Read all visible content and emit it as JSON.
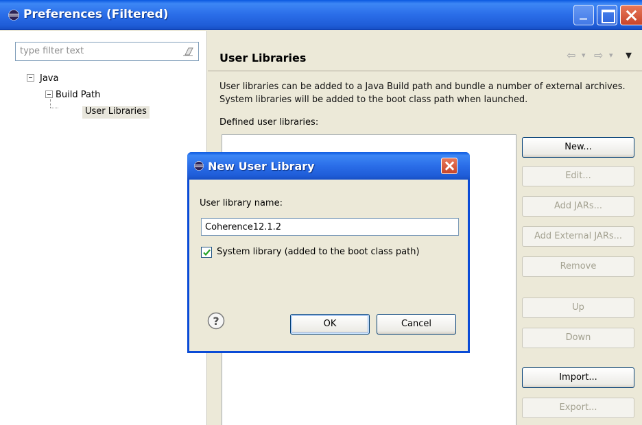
{
  "window": {
    "title": "Preferences (Filtered)"
  },
  "left_pane": {
    "filter_placeholder": "type filter text",
    "tree": {
      "java": "Java",
      "build_path": "Build Path",
      "user_libraries": "User Libraries"
    }
  },
  "right_pane": {
    "title": "User Libraries",
    "description": "User libraries can be added to a Java Build path and bundle a number of external archives. System libraries will be added to the boot class path when launched.",
    "defined_label": "Defined user libraries:",
    "nav": {
      "back": "⇦",
      "forward": "⇨",
      "menu": "▾",
      "dropdown": "▾"
    },
    "buttons": {
      "new": "New...",
      "edit": "Edit...",
      "add_jars": "Add JARs...",
      "add_external_jars": "Add External JARs...",
      "remove": "Remove",
      "up": "Up",
      "down": "Down",
      "import": "Import...",
      "export": "Export..."
    }
  },
  "dialog": {
    "title": "New User Library",
    "name_label": "User library name:",
    "name_value": "Coherence12.1.2",
    "system_library_label": "System library (added to the boot class path)",
    "system_library_checked": true,
    "ok_label": "OK",
    "cancel_label": "Cancel"
  },
  "colors": {
    "titlebar_blue": "#2a6de8",
    "close_red": "#c8452a",
    "dialog_border": "#0a4bd6",
    "window_bg": "#ece9d8"
  }
}
